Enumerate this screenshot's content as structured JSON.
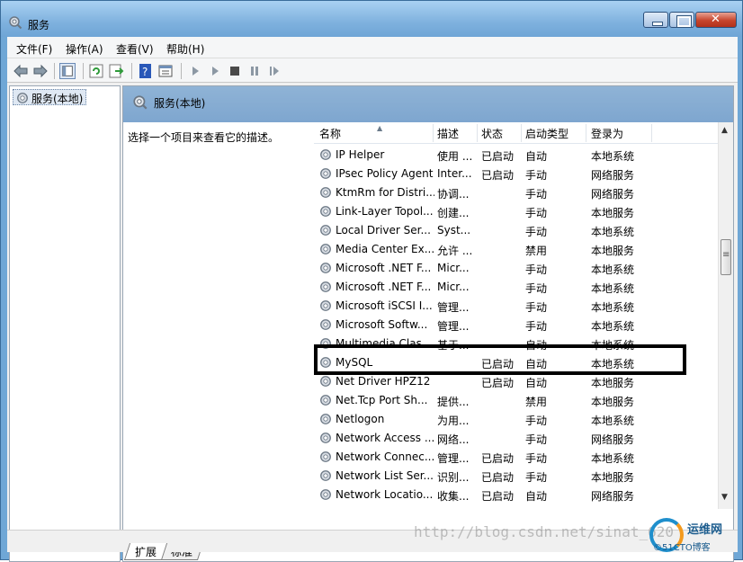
{
  "window": {
    "title": "服务"
  },
  "menu": [
    {
      "label": "文件(F)"
    },
    {
      "label": "操作(A)"
    },
    {
      "label": "查看(V)"
    },
    {
      "label": "帮助(H)"
    }
  ],
  "tree": {
    "root_label": "服务(本地)"
  },
  "right_header": {
    "title": "服务(本地)"
  },
  "description_hint": "选择一个项目来查看它的描述。",
  "columns": {
    "name": "名称",
    "desc": "描述",
    "status": "状态",
    "start": "启动类型",
    "login": "登录为"
  },
  "rows": [
    {
      "name": "IP Helper",
      "desc": "使用 ...",
      "status": "已启动",
      "start": "自动",
      "login": "本地系统"
    },
    {
      "name": "IPsec Policy Agent",
      "desc": "Inter...",
      "status": "已启动",
      "start": "手动",
      "login": "网络服务"
    },
    {
      "name": "KtmRm for Distri...",
      "desc": "协调...",
      "status": "",
      "start": "手动",
      "login": "网络服务"
    },
    {
      "name": "Link-Layer Topol...",
      "desc": "创建...",
      "status": "",
      "start": "手动",
      "login": "本地服务"
    },
    {
      "name": "Local Driver Ser...",
      "desc": "Syst...",
      "status": "",
      "start": "手动",
      "login": "本地系统"
    },
    {
      "name": "Media Center Ex...",
      "desc": "允许 ...",
      "status": "",
      "start": "禁用",
      "login": "本地服务"
    },
    {
      "name": "Microsoft .NET F...",
      "desc": "Micr...",
      "status": "",
      "start": "手动",
      "login": "本地系统"
    },
    {
      "name": "Microsoft .NET F...",
      "desc": "Micr...",
      "status": "",
      "start": "手动",
      "login": "本地系统"
    },
    {
      "name": "Microsoft iSCSI I...",
      "desc": "管理...",
      "status": "",
      "start": "手动",
      "login": "本地系统"
    },
    {
      "name": "Microsoft Softw...",
      "desc": "管理...",
      "status": "",
      "start": "手动",
      "login": "本地系统"
    },
    {
      "name": "Multimedia Clas...",
      "desc": "基于...",
      "status": "",
      "start": "自动",
      "login": "本地系统"
    },
    {
      "name": "MySQL",
      "desc": "",
      "status": "已启动",
      "start": "自动",
      "login": "本地系统"
    },
    {
      "name": "Net Driver HPZ12",
      "desc": "",
      "status": "已启动",
      "start": "自动",
      "login": "本地服务"
    },
    {
      "name": "Net.Tcp Port Sh...",
      "desc": "提供...",
      "status": "",
      "start": "禁用",
      "login": "本地服务"
    },
    {
      "name": "Netlogon",
      "desc": "为用...",
      "status": "",
      "start": "手动",
      "login": "本地系统"
    },
    {
      "name": "Network Access ...",
      "desc": "网络...",
      "status": "",
      "start": "手动",
      "login": "网络服务"
    },
    {
      "name": "Network Connec...",
      "desc": "管理...",
      "status": "已启动",
      "start": "手动",
      "login": "本地系统"
    },
    {
      "name": "Network List Ser...",
      "desc": "识别...",
      "status": "已启动",
      "start": "手动",
      "login": "本地服务"
    },
    {
      "name": "Network Locatio...",
      "desc": "收集...",
      "status": "已启动",
      "start": "自动",
      "login": "网络服务"
    }
  ],
  "tabs": [
    {
      "label": "扩展"
    },
    {
      "label": "标准"
    }
  ],
  "watermark": "http://blog.csdn.net/sinat_620",
  "logo": {
    "brand": "运维网",
    "sub": "©51CTO博客"
  }
}
